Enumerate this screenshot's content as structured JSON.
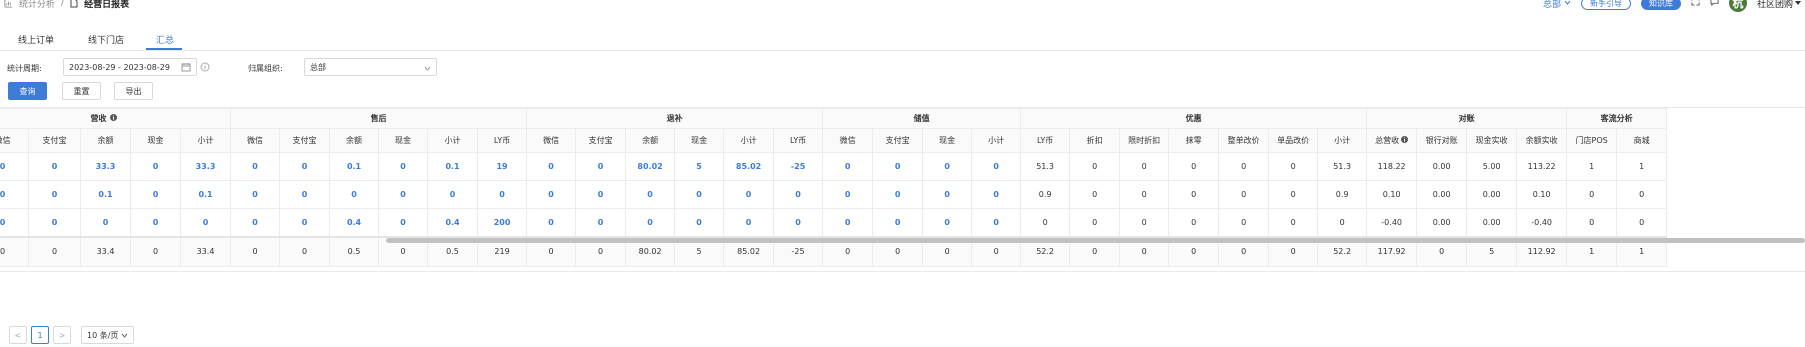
{
  "breadcrumb": {
    "parent": "统计分析",
    "separator": "/",
    "current": "经营日报表"
  },
  "header": {
    "org_select": "总部",
    "guide_button": "新手引导",
    "primary_button": "知识库",
    "avatar_text": "杭",
    "user_name": "社区团购"
  },
  "tabs": [
    {
      "label": "线上订单"
    },
    {
      "label": "线下门店"
    },
    {
      "label": "汇总"
    }
  ],
  "filters": {
    "period_label": "统计周期:",
    "period_value": "2023-08-29 - 2023-08-29",
    "org_label": "归属组织:",
    "org_value": "总部"
  },
  "actions": {
    "query": "查询",
    "reset": "重置",
    "export": "导出"
  },
  "table": {
    "groups": [
      {
        "label": "营收",
        "span": 5,
        "info": true
      },
      {
        "label": "售后",
        "span": 6
      },
      {
        "label": "退补",
        "span": 6
      },
      {
        "label": "储值",
        "span": 4
      },
      {
        "label": "优惠",
        "span": 7
      },
      {
        "label": "对账",
        "span": 4
      },
      {
        "label": "客流分析",
        "span": 2
      }
    ],
    "columns": [
      {
        "label": "微信"
      },
      {
        "label": "支付宝"
      },
      {
        "label": "余额"
      },
      {
        "label": "现金"
      },
      {
        "label": "小计"
      },
      {
        "label": "微信"
      },
      {
        "label": "支付宝"
      },
      {
        "label": "余额"
      },
      {
        "label": "现金"
      },
      {
        "label": "小计"
      },
      {
        "label": "LY币"
      },
      {
        "label": "微信"
      },
      {
        "label": "支付宝"
      },
      {
        "label": "余额"
      },
      {
        "label": "现金"
      },
      {
        "label": "小计"
      },
      {
        "label": "LY币"
      },
      {
        "label": "微信"
      },
      {
        "label": "支付宝"
      },
      {
        "label": "现金"
      },
      {
        "label": "小计"
      },
      {
        "label": "LY币"
      },
      {
        "label": "折扣"
      },
      {
        "label": "限时折扣"
      },
      {
        "label": "抹零"
      },
      {
        "label": "整单改价"
      },
      {
        "label": "单品改价"
      },
      {
        "label": "小计"
      },
      {
        "label": "总营收",
        "info": true
      },
      {
        "label": "银行对账"
      },
      {
        "label": "现金实收"
      },
      {
        "label": "余额实收"
      },
      {
        "label": "门店POS"
      },
      {
        "label": "商城"
      }
    ],
    "link_columns": 21,
    "rows": [
      [
        "0",
        "0",
        "33.3",
        "0",
        "33.3",
        "0",
        "0",
        "0.1",
        "0",
        "0.1",
        "19",
        "0",
        "0",
        "80.02",
        "5",
        "85.02",
        "-25",
        "0",
        "0",
        "0",
        "0",
        "51.3",
        "0",
        "0",
        "0",
        "0",
        "0",
        "51.3",
        "118.22",
        "0.00",
        "5.00",
        "113.22",
        "1",
        "1"
      ],
      [
        "0",
        "0",
        "0.1",
        "0",
        "0.1",
        "0",
        "0",
        "0",
        "0",
        "0",
        "0",
        "0",
        "0",
        "0",
        "0",
        "0",
        "0",
        "0",
        "0",
        "0",
        "0",
        "0.9",
        "0",
        "0",
        "0",
        "0",
        "0",
        "0.9",
        "0.10",
        "0.00",
        "0.00",
        "0.10",
        "0",
        "0"
      ],
      [
        "0",
        "0",
        "0",
        "0",
        "0",
        "0",
        "0",
        "0.4",
        "0",
        "0.4",
        "200",
        "0",
        "0",
        "0",
        "0",
        "0",
        "0",
        "0",
        "0",
        "0",
        "0",
        "0",
        "0",
        "0",
        "0",
        "0",
        "0",
        "0",
        "-0.40",
        "0.00",
        "0.00",
        "-0.40",
        "0",
        "0"
      ]
    ],
    "total": [
      "0",
      "0",
      "33.4",
      "0",
      "33.4",
      "0",
      "0",
      "0.5",
      "0",
      "0.5",
      "219",
      "0",
      "0",
      "80.02",
      "5",
      "85.02",
      "-25",
      "0",
      "0",
      "0",
      "0",
      "52.2",
      "0",
      "0",
      "0",
      "0",
      "0",
      "52.2",
      "117.92",
      "0",
      "5",
      "112.92",
      "1",
      "1"
    ]
  },
  "pagination": {
    "prev": "<",
    "current_page": "1",
    "next": ">",
    "page_size": "10 条/页"
  },
  "colors": {
    "accent": "#3d7bd9",
    "border": "#ececec",
    "header_bg": "#fafafa"
  }
}
